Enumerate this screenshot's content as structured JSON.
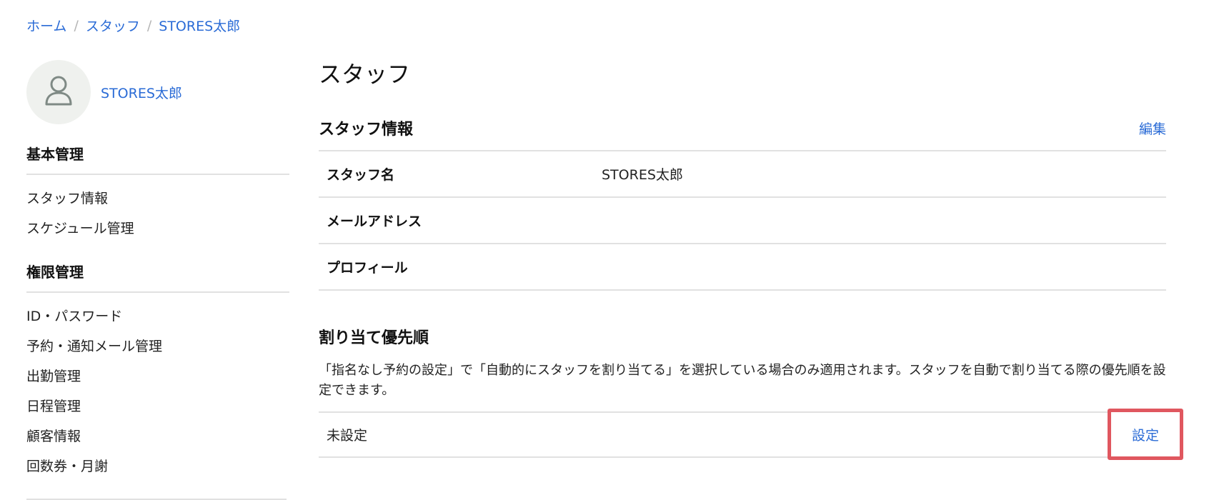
{
  "breadcrumb": {
    "items": [
      "ホーム",
      "スタッフ",
      "STORES太郎"
    ],
    "separator": "/"
  },
  "profile": {
    "name": "STORES太郎",
    "icon": "user-icon"
  },
  "sidebar": {
    "sections": [
      {
        "title": "基本管理",
        "items": [
          "スタッフ情報",
          "スケジュール管理"
        ]
      },
      {
        "title": "権限管理",
        "items": [
          "ID・パスワード",
          "予約・通知メール管理",
          "出勤管理",
          "日程管理",
          "顧客情報",
          "回数券・月謝"
        ]
      }
    ]
  },
  "main": {
    "title": "スタッフ",
    "staff_info": {
      "title": "スタッフ情報",
      "edit_label": "編集",
      "rows": [
        {
          "label": "スタッフ名",
          "value": "STORES太郎"
        },
        {
          "label": "メールアドレス",
          "value": ""
        },
        {
          "label": "プロフィール",
          "value": ""
        }
      ]
    },
    "priority": {
      "title": "割り当て優先順",
      "description": "「指名なし予約の設定」で「自動的にスタッフを割り当てる」を選択している場合のみ適用されます。スタッフを自動で割り当てる際の優先順を設定できます。",
      "status": "未設定",
      "setting_label": "設定"
    }
  },
  "colors": {
    "link": "#2a6bd6",
    "highlight": "#e0575f",
    "avatar_bg": "#eff1ee",
    "divider": "#e1e1e1"
  }
}
